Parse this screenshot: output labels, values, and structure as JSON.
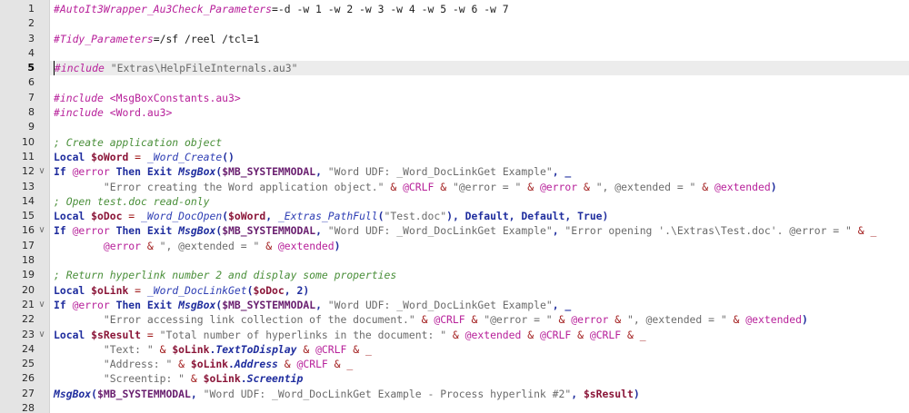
{
  "editor": {
    "current_line": 5,
    "lines": [
      {
        "n": "1",
        "fold": "",
        "tokens": [
          {
            "t": "#AutoIt3Wrapper_Au3Check_Parameters",
            "c": "t-directive"
          },
          {
            "t": "=-d -w 1 -w 2 -w 3 -w 4 -w 5 -w 6 -w 7",
            "c": "t-plain"
          }
        ]
      },
      {
        "n": "2",
        "fold": "",
        "tokens": []
      },
      {
        "n": "3",
        "fold": "",
        "tokens": [
          {
            "t": "#Tidy_Parameters",
            "c": "t-directive"
          },
          {
            "t": "=/sf /reel /tcl=1",
            "c": "t-plain"
          }
        ]
      },
      {
        "n": "4",
        "fold": "",
        "tokens": []
      },
      {
        "n": "5",
        "fold": "",
        "tokens": [
          {
            "t": "#include",
            "c": "t-directive"
          },
          {
            "t": " ",
            "c": "t-plain"
          },
          {
            "t": "\"Extras\\HelpFileInternals.au3\"",
            "c": "t-str"
          }
        ]
      },
      {
        "n": "6",
        "fold": "",
        "tokens": []
      },
      {
        "n": "7",
        "fold": "",
        "tokens": [
          {
            "t": "#include",
            "c": "t-directive"
          },
          {
            "t": " <MsgBoxConstants.au3>",
            "c": "t-include"
          }
        ]
      },
      {
        "n": "8",
        "fold": "",
        "tokens": [
          {
            "t": "#include",
            "c": "t-directive"
          },
          {
            "t": " <Word.au3>",
            "c": "t-include"
          }
        ]
      },
      {
        "n": "9",
        "fold": "",
        "tokens": []
      },
      {
        "n": "10",
        "fold": "",
        "tokens": [
          {
            "t": "; Create application object",
            "c": "t-comment"
          }
        ]
      },
      {
        "n": "11",
        "fold": "",
        "tokens": [
          {
            "t": "Local",
            "c": "t-kw"
          },
          {
            "t": " ",
            "c": "t-plain"
          },
          {
            "t": "$oWord",
            "c": "t-var"
          },
          {
            "t": " = ",
            "c": "t-op"
          },
          {
            "t": "_Word_Create",
            "c": "t-udf"
          },
          {
            "t": "()",
            "c": "t-kw"
          }
        ]
      },
      {
        "n": "12",
        "fold": "∨",
        "tokens": [
          {
            "t": "If",
            "c": "t-kw"
          },
          {
            "t": " ",
            "c": "t-plain"
          },
          {
            "t": "@error",
            "c": "t-macro"
          },
          {
            "t": " ",
            "c": "t-plain"
          },
          {
            "t": "Then",
            "c": "t-kw"
          },
          {
            "t": " ",
            "c": "t-plain"
          },
          {
            "t": "Exit",
            "c": "t-kw"
          },
          {
            "t": " ",
            "c": "t-plain"
          },
          {
            "t": "MsgBox",
            "c": "t-func"
          },
          {
            "t": "(",
            "c": "t-kw"
          },
          {
            "t": "$MB_SYSTEMMODAL",
            "c": "t-const"
          },
          {
            "t": ", ",
            "c": "t-kw"
          },
          {
            "t": "\"Word UDF: _Word_DocLinkGet Example\"",
            "c": "t-str"
          },
          {
            "t": ", _",
            "c": "t-kw"
          }
        ]
      },
      {
        "n": "13",
        "fold": "",
        "tokens": [
          {
            "t": "        ",
            "c": "t-plain"
          },
          {
            "t": "\"Error creating the Word application object.\"",
            "c": "t-str"
          },
          {
            "t": " & ",
            "c": "t-op"
          },
          {
            "t": "@CRLF",
            "c": "t-macro"
          },
          {
            "t": " & ",
            "c": "t-op"
          },
          {
            "t": "\"@error = \"",
            "c": "t-str"
          },
          {
            "t": " & ",
            "c": "t-op"
          },
          {
            "t": "@error",
            "c": "t-macro"
          },
          {
            "t": " & ",
            "c": "t-op"
          },
          {
            "t": "\", @extended = \"",
            "c": "t-str"
          },
          {
            "t": " & ",
            "c": "t-op"
          },
          {
            "t": "@extended",
            "c": "t-macro"
          },
          {
            "t": ")",
            "c": "t-kw"
          }
        ]
      },
      {
        "n": "14",
        "fold": "",
        "tokens": [
          {
            "t": "; Open test.doc read-only",
            "c": "t-comment"
          }
        ]
      },
      {
        "n": "15",
        "fold": "",
        "tokens": [
          {
            "t": "Local",
            "c": "t-kw"
          },
          {
            "t": " ",
            "c": "t-plain"
          },
          {
            "t": "$oDoc",
            "c": "t-var"
          },
          {
            "t": " = ",
            "c": "t-op"
          },
          {
            "t": "_Word_DocOpen",
            "c": "t-udf"
          },
          {
            "t": "(",
            "c": "t-kw"
          },
          {
            "t": "$oWord",
            "c": "t-var"
          },
          {
            "t": ", ",
            "c": "t-kw"
          },
          {
            "t": "_Extras_PathFull",
            "c": "t-udf"
          },
          {
            "t": "(",
            "c": "t-kw"
          },
          {
            "t": "\"Test.doc\"",
            "c": "t-str"
          },
          {
            "t": "), Default, Default, True)",
            "c": "t-kw"
          }
        ]
      },
      {
        "n": "16",
        "fold": "∨",
        "tokens": [
          {
            "t": "If",
            "c": "t-kw"
          },
          {
            "t": " ",
            "c": "t-plain"
          },
          {
            "t": "@error",
            "c": "t-macro"
          },
          {
            "t": " ",
            "c": "t-plain"
          },
          {
            "t": "Then",
            "c": "t-kw"
          },
          {
            "t": " ",
            "c": "t-plain"
          },
          {
            "t": "Exit",
            "c": "t-kw"
          },
          {
            "t": " ",
            "c": "t-plain"
          },
          {
            "t": "MsgBox",
            "c": "t-func"
          },
          {
            "t": "(",
            "c": "t-kw"
          },
          {
            "t": "$MB_SYSTEMMODAL",
            "c": "t-const"
          },
          {
            "t": ", ",
            "c": "t-kw"
          },
          {
            "t": "\"Word UDF: _Word_DocLinkGet Example\"",
            "c": "t-str"
          },
          {
            "t": ", ",
            "c": "t-kw"
          },
          {
            "t": "\"Error opening '.\\Extras\\Test.doc'.",
            "c": "t-str"
          },
          {
            "t": " @error = \"",
            "c": "t-str"
          },
          {
            "t": " & _",
            "c": "t-op"
          }
        ]
      },
      {
        "n": "17",
        "fold": "",
        "tokens": [
          {
            "t": "        ",
            "c": "t-plain"
          },
          {
            "t": "@error",
            "c": "t-macro"
          },
          {
            "t": " & ",
            "c": "t-op"
          },
          {
            "t": "\", @extended = \"",
            "c": "t-str"
          },
          {
            "t": " & ",
            "c": "t-op"
          },
          {
            "t": "@extended",
            "c": "t-macro"
          },
          {
            "t": ")",
            "c": "t-kw"
          }
        ]
      },
      {
        "n": "18",
        "fold": "",
        "tokens": []
      },
      {
        "n": "19",
        "fold": "",
        "tokens": [
          {
            "t": "; Return hyperlink number 2 and display some properties",
            "c": "t-comment"
          }
        ]
      },
      {
        "n": "20",
        "fold": "",
        "tokens": [
          {
            "t": "Local",
            "c": "t-kw"
          },
          {
            "t": " ",
            "c": "t-plain"
          },
          {
            "t": "$oLink",
            "c": "t-var"
          },
          {
            "t": " = ",
            "c": "t-op"
          },
          {
            "t": "_Word_DocLinkGet",
            "c": "t-udf"
          },
          {
            "t": "(",
            "c": "t-kw"
          },
          {
            "t": "$oDoc",
            "c": "t-var"
          },
          {
            "t": ", 2)",
            "c": "t-kw"
          }
        ]
      },
      {
        "n": "21",
        "fold": "∨",
        "tokens": [
          {
            "t": "If",
            "c": "t-kw"
          },
          {
            "t": " ",
            "c": "t-plain"
          },
          {
            "t": "@error",
            "c": "t-macro"
          },
          {
            "t": " ",
            "c": "t-plain"
          },
          {
            "t": "Then",
            "c": "t-kw"
          },
          {
            "t": " ",
            "c": "t-plain"
          },
          {
            "t": "Exit",
            "c": "t-kw"
          },
          {
            "t": " ",
            "c": "t-plain"
          },
          {
            "t": "MsgBox",
            "c": "t-func"
          },
          {
            "t": "(",
            "c": "t-kw"
          },
          {
            "t": "$MB_SYSTEMMODAL",
            "c": "t-const"
          },
          {
            "t": ", ",
            "c": "t-kw"
          },
          {
            "t": "\"Word UDF: _Word_DocLinkGet Example\"",
            "c": "t-str"
          },
          {
            "t": ", _",
            "c": "t-kw"
          }
        ]
      },
      {
        "n": "22",
        "fold": "",
        "tokens": [
          {
            "t": "        ",
            "c": "t-plain"
          },
          {
            "t": "\"Error accessing link collection of the document.\"",
            "c": "t-str"
          },
          {
            "t": " & ",
            "c": "t-op"
          },
          {
            "t": "@CRLF",
            "c": "t-macro"
          },
          {
            "t": " & ",
            "c": "t-op"
          },
          {
            "t": "\"@error = \"",
            "c": "t-str"
          },
          {
            "t": " & ",
            "c": "t-op"
          },
          {
            "t": "@error",
            "c": "t-macro"
          },
          {
            "t": " & ",
            "c": "t-op"
          },
          {
            "t": "\", @extended = \"",
            "c": "t-str"
          },
          {
            "t": " & ",
            "c": "t-op"
          },
          {
            "t": "@extended",
            "c": "t-macro"
          },
          {
            "t": ")",
            "c": "t-kw"
          }
        ]
      },
      {
        "n": "23",
        "fold": "∨",
        "tokens": [
          {
            "t": "Local",
            "c": "t-kw"
          },
          {
            "t": " ",
            "c": "t-plain"
          },
          {
            "t": "$sResult",
            "c": "t-var"
          },
          {
            "t": " = ",
            "c": "t-op"
          },
          {
            "t": "\"Total number of hyperlinks in the document: \"",
            "c": "t-str"
          },
          {
            "t": " & ",
            "c": "t-op"
          },
          {
            "t": "@extended",
            "c": "t-macro"
          },
          {
            "t": " & ",
            "c": "t-op"
          },
          {
            "t": "@CRLF",
            "c": "t-macro"
          },
          {
            "t": " & ",
            "c": "t-op"
          },
          {
            "t": "@CRLF",
            "c": "t-macro"
          },
          {
            "t": " & _",
            "c": "t-op"
          }
        ]
      },
      {
        "n": "24",
        "fold": "",
        "tokens": [
          {
            "t": "        ",
            "c": "t-plain"
          },
          {
            "t": "\"Text: \"",
            "c": "t-str"
          },
          {
            "t": " & ",
            "c": "t-op"
          },
          {
            "t": "$oLink",
            "c": "t-var"
          },
          {
            "t": ".",
            "c": "t-kw"
          },
          {
            "t": "TextToDisplay",
            "c": "t-func"
          },
          {
            "t": " & ",
            "c": "t-op"
          },
          {
            "t": "@CRLF",
            "c": "t-macro"
          },
          {
            "t": " & _",
            "c": "t-op"
          }
        ]
      },
      {
        "n": "25",
        "fold": "",
        "tokens": [
          {
            "t": "        ",
            "c": "t-plain"
          },
          {
            "t": "\"Address: \"",
            "c": "t-str"
          },
          {
            "t": " & ",
            "c": "t-op"
          },
          {
            "t": "$oLink",
            "c": "t-var"
          },
          {
            "t": ".",
            "c": "t-kw"
          },
          {
            "t": "Address",
            "c": "t-func"
          },
          {
            "t": " & ",
            "c": "t-op"
          },
          {
            "t": "@CRLF",
            "c": "t-macro"
          },
          {
            "t": " & _",
            "c": "t-op"
          }
        ]
      },
      {
        "n": "26",
        "fold": "",
        "tokens": [
          {
            "t": "        ",
            "c": "t-plain"
          },
          {
            "t": "\"Screentip: \"",
            "c": "t-str"
          },
          {
            "t": " & ",
            "c": "t-op"
          },
          {
            "t": "$oLink",
            "c": "t-var"
          },
          {
            "t": ".",
            "c": "t-kw"
          },
          {
            "t": "Screentip",
            "c": "t-func"
          }
        ]
      },
      {
        "n": "27",
        "fold": "",
        "tokens": [
          {
            "t": "MsgBox",
            "c": "t-func"
          },
          {
            "t": "(",
            "c": "t-kw"
          },
          {
            "t": "$MB_SYSTEMMODAL",
            "c": "t-const"
          },
          {
            "t": ", ",
            "c": "t-kw"
          },
          {
            "t": "\"Word UDF: _Word_DocLinkGet Example - Process hyperlink #2\"",
            "c": "t-str"
          },
          {
            "t": ", ",
            "c": "t-kw"
          },
          {
            "t": "$sResult",
            "c": "t-var"
          },
          {
            "t": ")",
            "c": "t-kw"
          }
        ]
      },
      {
        "n": "28",
        "fold": "",
        "tokens": []
      }
    ]
  }
}
